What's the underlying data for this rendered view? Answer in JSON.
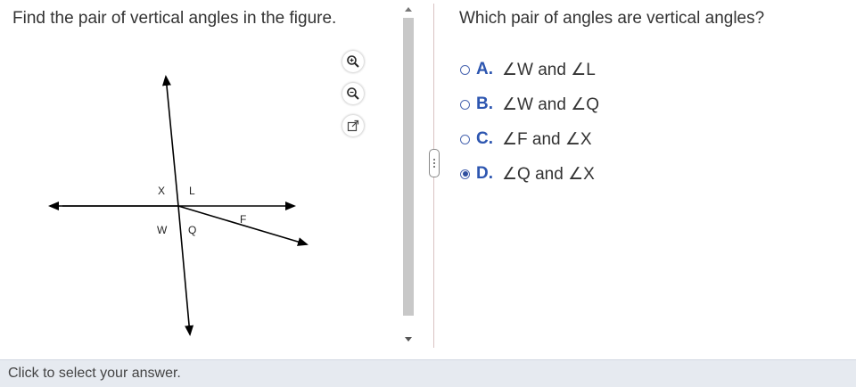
{
  "question": {
    "instruction": "Find the pair of vertical angles in the figure."
  },
  "figure": {
    "labels": {
      "x": "X",
      "l": "L",
      "w": "W",
      "q": "Q",
      "f": "F"
    }
  },
  "tools": [
    {
      "name": "zoom-in",
      "icon": "zoom-in-icon"
    },
    {
      "name": "zoom-out",
      "icon": "zoom-out-icon"
    },
    {
      "name": "open-popup",
      "icon": "external-link-icon"
    }
  ],
  "answer": {
    "prompt": "Which pair of angles are vertical angles?",
    "options": [
      {
        "letter": "A.",
        "text": "∠W and ∠L",
        "selected": false
      },
      {
        "letter": "B.",
        "text": "∠W and ∠Q",
        "selected": false
      },
      {
        "letter": "C.",
        "text": "∠F and ∠X",
        "selected": false
      },
      {
        "letter": "D.",
        "text": "∠Q and ∠X",
        "selected": true
      }
    ]
  },
  "status": {
    "text": "Click to select your answer."
  },
  "colors": {
    "accent": "#2d56b0",
    "status_bg": "#e6eaf0",
    "scroll_thumb": "#c8c8c8"
  }
}
